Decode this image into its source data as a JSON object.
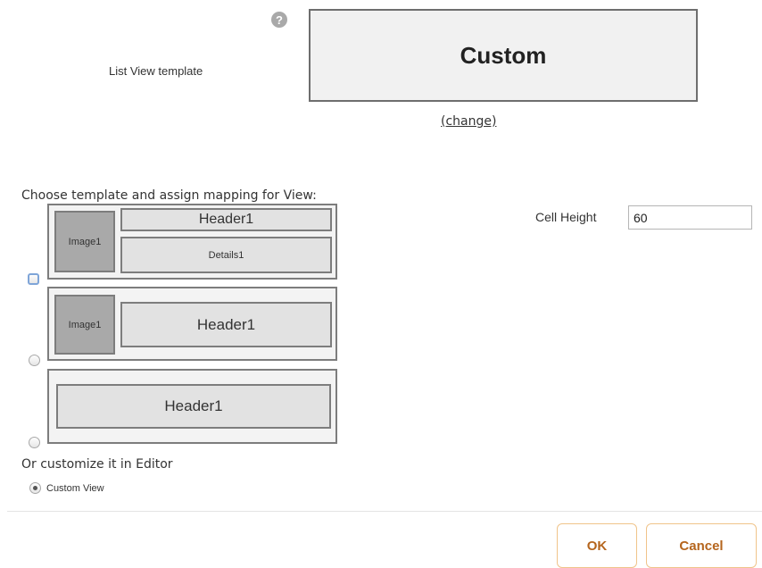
{
  "list_view": {
    "label": "List View template",
    "help_icon": "question-icon",
    "selected_template": "Custom",
    "change_link": "(change)"
  },
  "templates": {
    "choose_label": "Choose template and assign mapping for View:",
    "t1": {
      "image": "Image1",
      "header": "Header1",
      "details": "Details1"
    },
    "t2": {
      "image": "Image1",
      "header": "Header1"
    },
    "t3": {
      "header": "Header1"
    },
    "or_label": "Or customize it in Editor",
    "custom_view_label": "Custom View"
  },
  "cell_height": {
    "label": "Cell Height",
    "value": "60"
  },
  "buttons": {
    "ok": "OK",
    "cancel": "Cancel"
  }
}
